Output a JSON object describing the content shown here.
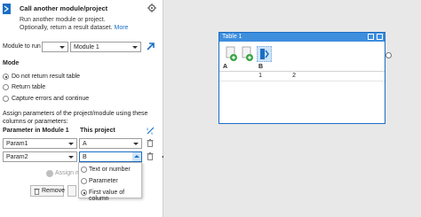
{
  "header": {
    "title": "Call another module/project",
    "description": "Run another module or project. Optionally, return a result dataset.",
    "more_link": "More"
  },
  "module_to_run": {
    "label": "Module to run",
    "selected": "Module 1"
  },
  "mode": {
    "label": "Mode",
    "options": [
      {
        "label": "Do not return result table",
        "checked": true
      },
      {
        "label": "Return table",
        "checked": false
      },
      {
        "label": "Capture errors and continue",
        "checked": false
      }
    ]
  },
  "assign_text": "Assign parameters of the project/module using these columns or parameters:",
  "param_table": {
    "col_param": "Parameter in Module 1",
    "col_project": "This project",
    "rows": [
      {
        "param": "Param1",
        "value": "A"
      },
      {
        "param": "Param2",
        "value": "B"
      }
    ]
  },
  "assign_more_label": "Assign m",
  "buttons": {
    "remove": "Remove"
  },
  "popup": {
    "options": [
      {
        "label": "Text or number",
        "checked": false
      },
      {
        "label": "Parameter",
        "checked": false
      },
      {
        "label": "First value of column",
        "checked": true
      }
    ]
  },
  "table_window": {
    "title": "Table 1",
    "columns": [
      "A",
      "B"
    ],
    "rows": [
      [
        "1",
        "2"
      ]
    ]
  },
  "colors": {
    "accent": "#1a6fc4",
    "titlebar": "#3e8ede",
    "canvas": "#e8e8e8"
  }
}
